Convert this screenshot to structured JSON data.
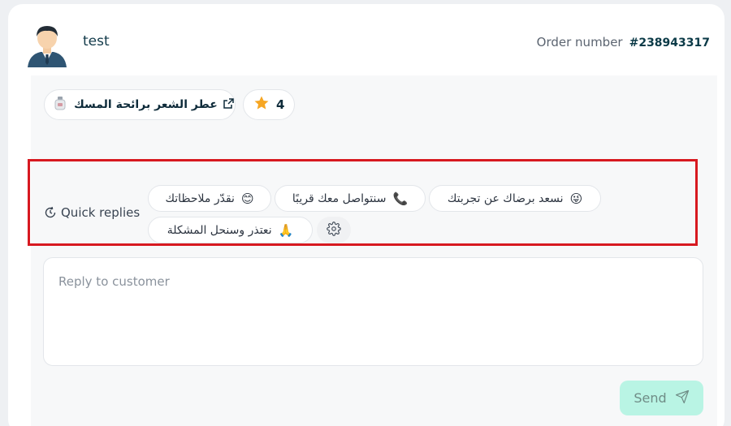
{
  "customer": {
    "name": "test",
    "avatar_icon": "avatar-man-icon"
  },
  "order": {
    "label": "Order number",
    "number": "#238943317"
  },
  "product": {
    "name": "عطر الشعر برائحة المسك",
    "thumb_icon": "perfume-bottle-icon",
    "link_icon": "external-link-icon"
  },
  "rating": {
    "value": "4",
    "icon": "star-icon"
  },
  "quick_replies": {
    "label": "Quick replies",
    "icon": "refresh-icon",
    "items": [
      {
        "text": "نسعد برضاك عن تجربتك",
        "emoji": "😜"
      },
      {
        "text": "سنتواصل معك قريبًا",
        "emoji": "📞"
      },
      {
        "text": "نقدّر ملاحظاتك",
        "emoji": "😊"
      },
      {
        "text": "نعتذر وسنحل المشكلة",
        "emoji": "🙏"
      }
    ],
    "settings_icon": "gear-icon"
  },
  "reply": {
    "placeholder": "Reply to customer"
  },
  "send": {
    "label": "Send",
    "icon": "send-icon"
  },
  "colors": {
    "accent": "#b9f4e4",
    "highlight": "#d71920",
    "star": "#f6a623"
  }
}
